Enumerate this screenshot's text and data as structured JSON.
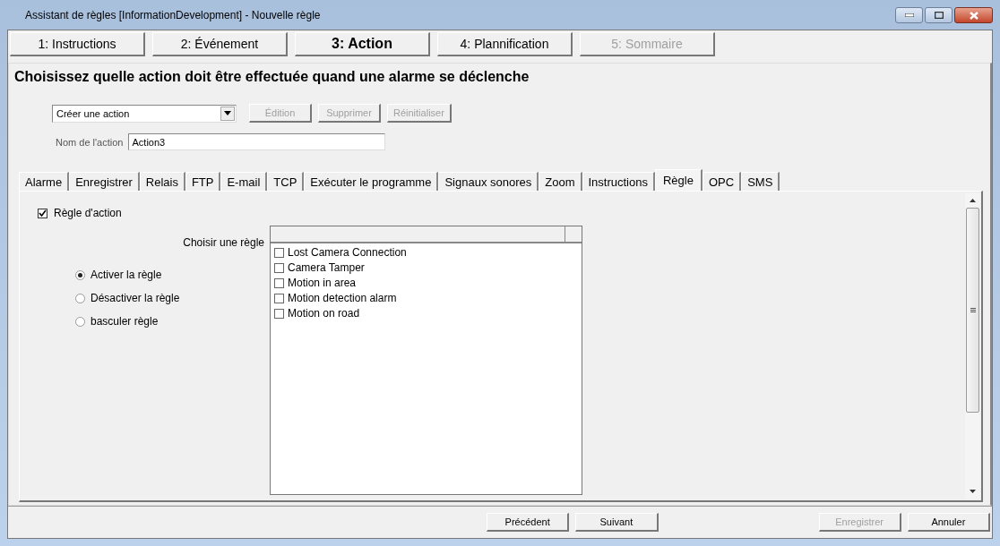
{
  "window": {
    "title": "Assistant de règles [InformationDevelopment] - Nouvelle règle"
  },
  "steps": [
    {
      "label": "1: Instructions",
      "selected": false,
      "disabled": false
    },
    {
      "label": "2: Événement",
      "selected": false,
      "disabled": false
    },
    {
      "label": "3: Action",
      "selected": true,
      "disabled": false
    },
    {
      "label": "4: Plannification",
      "selected": false,
      "disabled": false
    },
    {
      "label": "5: Sommaire",
      "selected": false,
      "disabled": true
    }
  ],
  "heading": "Choisissez quelle action doit être effectuée quand une alarme se déclenche",
  "action_select": {
    "value": "Créer une action"
  },
  "action_buttons": [
    {
      "label": "Édition",
      "disabled": true
    },
    {
      "label": "Supprimer",
      "disabled": true
    },
    {
      "label": "Réinitialiser",
      "disabled": true
    }
  ],
  "action_name": {
    "label": "Nom de l'action",
    "value": "Action3"
  },
  "tabs": [
    {
      "label": "Alarme",
      "selected": false
    },
    {
      "label": "Enregistrer",
      "selected": false
    },
    {
      "label": "Relais",
      "selected": false
    },
    {
      "label": "FTP",
      "selected": false
    },
    {
      "label": "E-mail",
      "selected": false
    },
    {
      "label": "TCP",
      "selected": false
    },
    {
      "label": "Exécuter le programme",
      "selected": false
    },
    {
      "label": "Signaux sonores",
      "selected": false
    },
    {
      "label": "Zoom",
      "selected": false
    },
    {
      "label": "Instructions",
      "selected": false
    },
    {
      "label": "Règle",
      "selected": true
    },
    {
      "label": "OPC",
      "selected": false
    },
    {
      "label": "SMS",
      "selected": false
    }
  ],
  "rule_checkbox": {
    "label": "Règle d'action",
    "checked": true
  },
  "choose_rule_label": "Choisir une règle",
  "radios": [
    {
      "label": "Activer la règle",
      "selected": true
    },
    {
      "label": "Désactiver la règle",
      "selected": false
    },
    {
      "label": "basculer règle",
      "selected": false
    }
  ],
  "rules": [
    {
      "label": "Lost Camera Connection",
      "checked": false
    },
    {
      "label": "Camera Tamper",
      "checked": false
    },
    {
      "label": "Motion in area",
      "checked": false
    },
    {
      "label": "Motion detection alarm",
      "checked": false
    },
    {
      "label": "Motion on road",
      "checked": false
    }
  ],
  "footer_buttons": [
    {
      "label": "Précédent",
      "disabled": false
    },
    {
      "label": "Suivant",
      "disabled": false
    },
    {
      "label": "Enregistrer",
      "disabled": true
    },
    {
      "label": "Annuler",
      "disabled": false
    }
  ]
}
